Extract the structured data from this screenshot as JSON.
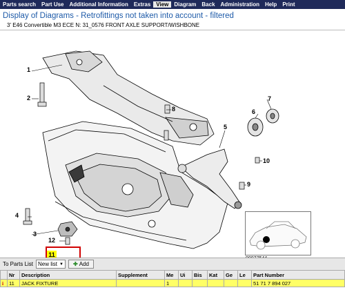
{
  "menu": [
    "Parts search",
    "Part Use",
    "Additional Information",
    "Extras",
    "View",
    "Diagram",
    "Back",
    "Administration",
    "Help",
    "Print"
  ],
  "menu_highlight": "View",
  "title": "Display of Diagrams - Retrofittings not taken into account - filtered",
  "subtitle": "3' E46 Convertible M3 ECE  N: 31_0576 FRONT AXLE SUPPORT/WISHBONE",
  "diagram": {
    "callouts": [
      {
        "id": "c1",
        "text": "1"
      },
      {
        "id": "c2",
        "text": "2"
      },
      {
        "id": "c3",
        "text": "3"
      },
      {
        "id": "c4",
        "text": "4"
      },
      {
        "id": "c5",
        "text": "5"
      },
      {
        "id": "c6",
        "text": "6"
      },
      {
        "id": "c7",
        "text": "7"
      },
      {
        "id": "c8",
        "text": "8"
      },
      {
        "id": "c9",
        "text": "9"
      },
      {
        "id": "c10",
        "text": "10"
      },
      {
        "id": "c11",
        "text": "11"
      },
      {
        "id": "c12",
        "text": "12"
      }
    ],
    "selected_part": "11",
    "image_id": "00077544"
  },
  "toolbar": {
    "to_parts_list": "To Parts List",
    "list_select": "New list",
    "add_label": "Add"
  },
  "table": {
    "headers": [
      "Nr",
      "Description",
      "Supplement",
      "Me",
      "Ui",
      "Bis",
      "Kat",
      "Ge",
      "Le",
      "Part Number"
    ],
    "rows": [
      {
        "flag": "i",
        "nr": "11",
        "description": "JACK FIXTURE",
        "supplement": "",
        "me": "1",
        "ui": "",
        "bis": "",
        "kat": "",
        "ge": "",
        "le": "",
        "part_number": "51 71 7 894 027"
      }
    ]
  }
}
